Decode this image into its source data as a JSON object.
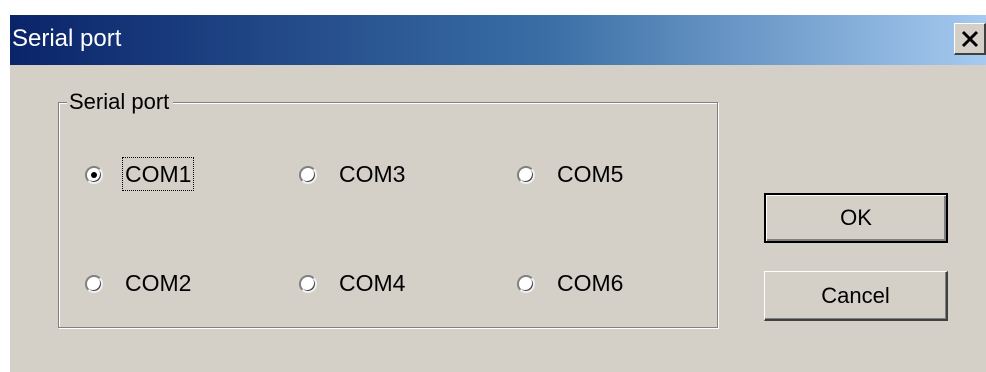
{
  "window": {
    "title": "Serial port",
    "close_icon": "close-icon"
  },
  "group": {
    "label": "Serial port"
  },
  "ports": [
    {
      "label": "COM1",
      "selected": true
    },
    {
      "label": "COM2",
      "selected": false
    },
    {
      "label": "COM3",
      "selected": false
    },
    {
      "label": "COM4",
      "selected": false
    },
    {
      "label": "COM5",
      "selected": false
    },
    {
      "label": "COM6",
      "selected": false
    }
  ],
  "buttons": {
    "ok_label": "OK",
    "cancel_label": "Cancel"
  },
  "colors": {
    "title_bar_start": "#0a246a",
    "title_bar_end": "#a6caf0",
    "face": "#d4d0c8"
  }
}
